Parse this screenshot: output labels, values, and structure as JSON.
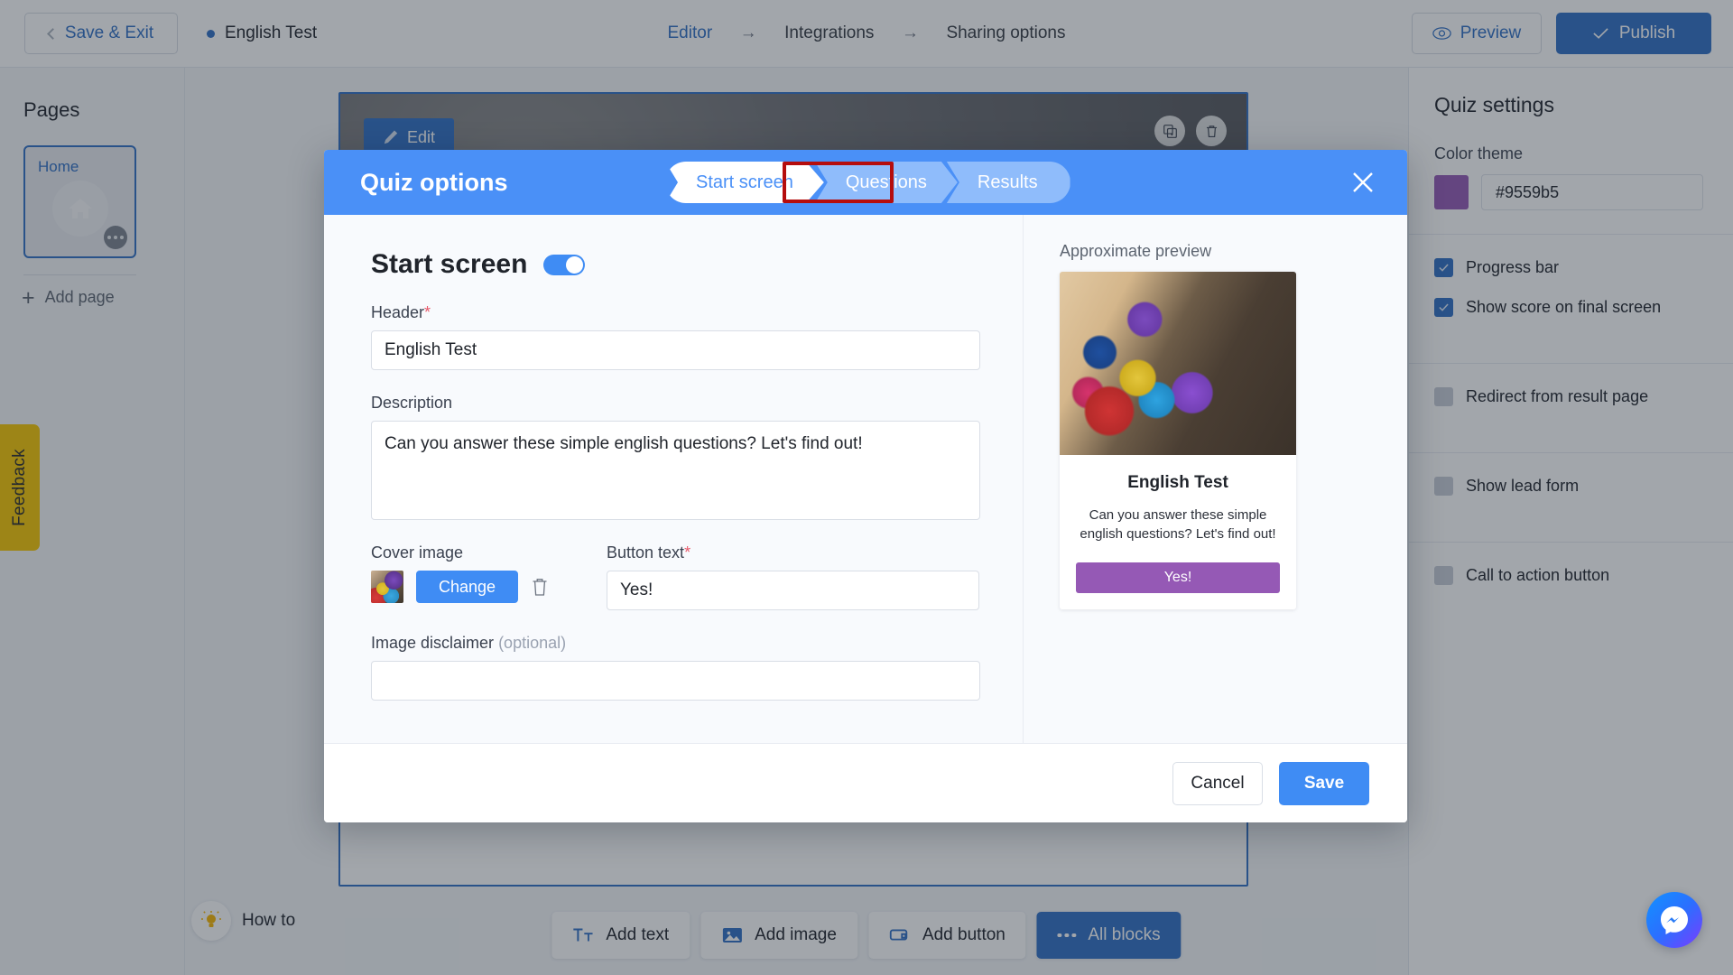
{
  "topbar": {
    "save_exit": "Save & Exit",
    "doc_title": "English Test",
    "breadcrumb": [
      "Editor",
      "Integrations",
      "Sharing options"
    ],
    "breadcrumb_arrow": "→",
    "preview": "Preview",
    "publish": "Publish"
  },
  "left_sidebar": {
    "title": "Pages",
    "page_card_label": "Home",
    "add_page": "Add page"
  },
  "feedback": {
    "label": "Feedback"
  },
  "canvas": {
    "edit_label": "Edit"
  },
  "block_toolbar": {
    "add_text": "Add text",
    "add_image": "Add image",
    "add_button": "Add button",
    "all_blocks": "All blocks"
  },
  "howto": {
    "label": "How to"
  },
  "right_panel": {
    "title": "Quiz settings",
    "color_theme_label": "Color theme",
    "color_theme_value": "#9559b5",
    "color_theme_swatch": "#9559b5",
    "options": [
      {
        "label": "Progress bar",
        "checked": true
      },
      {
        "label": "Show score on final screen",
        "checked": true
      },
      {
        "label": "Redirect from result page",
        "checked": false
      },
      {
        "label": "Show lead form",
        "checked": false
      },
      {
        "label": "Call to action button",
        "checked": false
      }
    ]
  },
  "modal": {
    "title": "Quiz options",
    "tabs": [
      {
        "label": "Start screen",
        "state": "active"
      },
      {
        "label": "Questions",
        "state": "highlighted"
      },
      {
        "label": "Results",
        "state": "inactive"
      }
    ],
    "section_title": "Start screen",
    "section_toggle_on": true,
    "header_label": "Header",
    "header_required": "*",
    "header_value": "English Test",
    "description_label": "Description",
    "description_value": "Can you answer these simple english questions? Let's find out!",
    "cover_image_label": "Cover image",
    "change_button": "Change",
    "button_text_label": "Button text",
    "button_text_required": "*",
    "button_text_value": "Yes!",
    "image_disclaimer_label": "Image disclaimer",
    "image_disclaimer_optional": "(optional)",
    "image_disclaimer_value": "",
    "preview_label": "Approximate preview",
    "preview_title": "English Test",
    "preview_desc": "Can you answer these simple english questions? Let's find out!",
    "preview_button": "Yes!",
    "preview_button_color": "#9559b5",
    "cancel": "Cancel",
    "save": "Save"
  }
}
